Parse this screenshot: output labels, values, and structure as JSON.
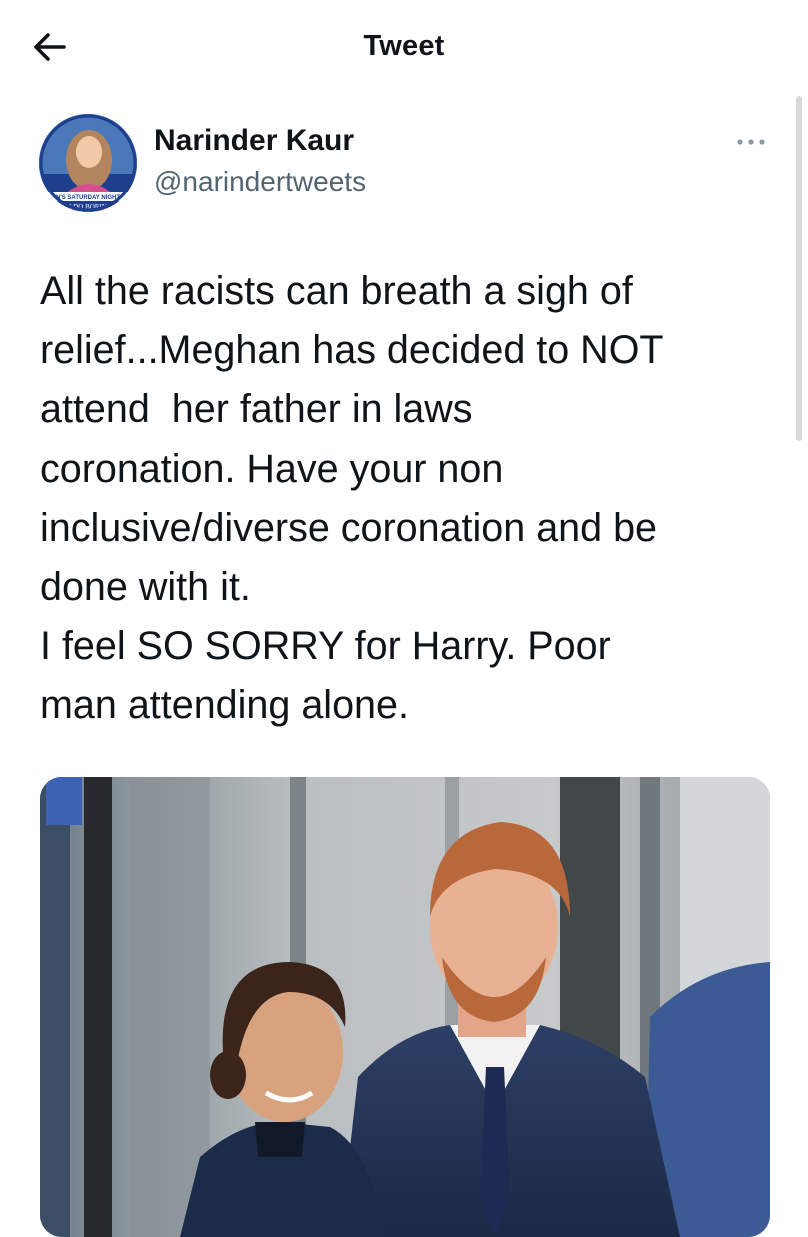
{
  "header": {
    "title": "Tweet",
    "back_icon": "arrow-left-icon"
  },
  "tweet": {
    "author": {
      "display_name": "Narinder Kaur",
      "handle": "@narindertweets",
      "avatar_banner_top": "N'S SATURDAY NIGHT",
      "avatar_banner_bottom": "I DO BORIN"
    },
    "more_icon": "more-horizontal-icon",
    "text": "All the racists can breath a sigh of\nrelief...Meghan has decided to NOT\nattend  her father in laws\ncoronation. Have your non\ninclusive/diverse coronation and be\ndone with it.\nI feel SO SORRY for Harry. Poor\nman attending alone."
  },
  "colors": {
    "text_primary": "#0f1419",
    "text_secondary": "#536471",
    "avatar_ring": "#1d3f8c"
  }
}
